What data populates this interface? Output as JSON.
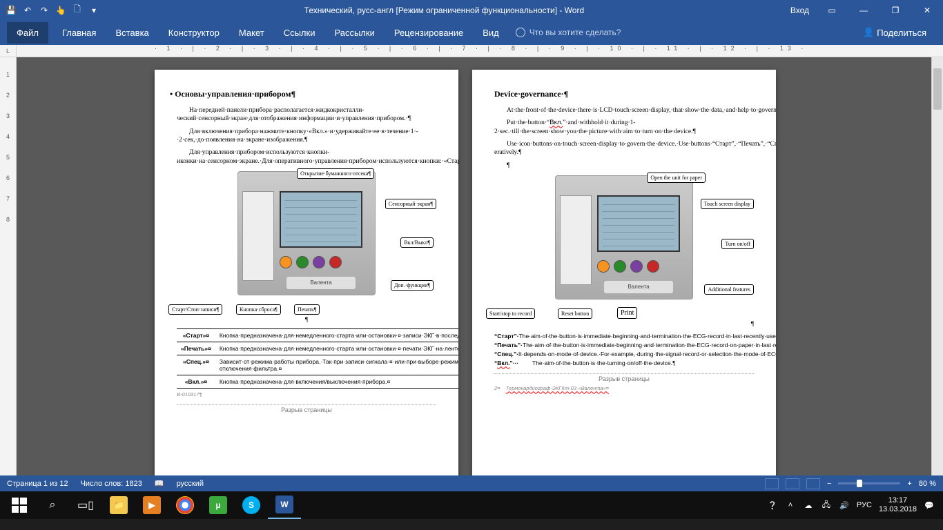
{
  "titlebar": {
    "title": "Технический, русс-англ [Режим ограниченной функциональности] - Word",
    "signin": "Вход"
  },
  "ribbon": {
    "file": "Файл",
    "home": "Главная",
    "insert": "Вставка",
    "design": "Конструктор",
    "layout": "Макет",
    "references": "Ссылки",
    "mailings": "Рассылки",
    "review": "Рецензирование",
    "view": "Вид",
    "tellme": "Что вы хотите сделать?",
    "share": "Поделиться"
  },
  "ruler": {
    "h": "· 1 · | · 2 · | · 3 · | · 4 · | · 5 · | · 6 · | · 7 · | · 8 · | · 9 · | · 10 · | · 11 · | · 12 · | · 13 ·",
    "corner": "L"
  },
  "page_left": {
    "heading": "Основы·управления·прибором¶",
    "p1": "На·передней·панели·прибора·располагается·жидкокристалли­ческий·сенсорный·экран·для·отображения·информации·и·управления·прибором.·¶",
    "p2": "Для·включения·прибора·нажмите·кнопку·«Вкл.»·и·удержи­вайте·ее·в·течение·1·-·2·сек,·до·появления·на·экране·изобра­жения.¶",
    "p3": "Для·управления·прибором·используются·кнопки-иконки·на·сенсорном·экране.·Для·оперативного·управления·прибором·используются·кнопки:·«Старт»,·«Печать»,·«Спец.».¶",
    "callouts": {
      "c1": "Открытие·бумажного·отсека¶",
      "c2": "Сенсорный·экран¶",
      "c3": "Вкл/Выкл¶",
      "c4": "Доп.·функции¶",
      "c5": "Старт/Стоп·записи¶",
      "c6": "Кнопка·сброса¶",
      "c7": "Печать¶"
    },
    "device_logo": "Валента",
    "para_sym": "¶",
    "table": [
      {
        "k": "«Старт»¤",
        "v": "Кнопка·предназначена·для·немедленного·старта·или·остановки·¤·записи·ЭКГ·в·последнем·использованном·режиме.·¤"
      },
      {
        "k": "«Печать»¤",
        "v": "Кнопка·предназначена·для·немедленного·старта·или·остановки·¤·печати·ЭКГ·на·ленте·в·последнем·использованном·режиме.¤"
      },
      {
        "k": "«Спец.»¤",
        "v": "Зависит·от·режима·работы·прибора.·Так·при·записи·сигнала·¤·или·при·выборе·режима·печати·ЭКГ·кнопка·«Спец.»·служит·¤·для·включения/отключения·фильтра.¤"
      },
      {
        "k": "«Вкл.»¤",
        "v": "Кнопка·предназначена·для·включения/выключения·прибора.¤"
      }
    ],
    "footnote": "В-010317¶",
    "pagebreak": "Разрыв страницы"
  },
  "page_right": {
    "heading": "Device·governance·¶",
    "p1": "At·the·front·of·the·device·there·is·LCD·touch·screen·display,·that·show·the·data,·and·help·to·govern·the·device.¶",
    "p2": "Put·the·button·“Вкл.”·and·withhold·it·during·1-2·sec.·till·the·screen·show·you·the·picture·with·aim·to·turn·on·the·device.¶",
    "p3": "Use·icon·buttons·on·touch·screen·display·to·govern·the·device.·Use·buttons·“Старт”,·“Печать”,·“Спец.”·for·govern·the·device·op­eratively.¶",
    "p4": "¶",
    "callouts": {
      "c1": "Open the unit for paper",
      "c2": "Touch screen display",
      "c3": "Turn on/off",
      "c4": "Additional features",
      "c5": "Start/stop to record",
      "c6": "Reset button",
      "c7": "Print"
    },
    "device_logo": "Валента",
    "para_sym": "¶",
    "defs": [
      {
        "k": "“Старт”·",
        "v": "The·aim·of·the·button·is·immediate·beginning·and·termination·the·ECG·record·in·last·recently·used·mode.¶"
      },
      {
        "k": "“Печать”·",
        "v": "The·aim·of·the·button·is·immediate·beginning·and·termination·the·ECG·record·on·paper·in·last·recently·used·mode¶"
      },
      {
        "k": "“Спец.”·",
        "v": "It·depends·on·mode·of·device.·For·example,·during·the·signal·record·or·selection·the·mode·of·ECG·print·the·aim·of·the·button·is·the·turning·on/off·the·filter.¶"
      },
      {
        "k": "“Вкл.”···",
        "v": "The·aim·of·the·button·is·the·turning·on/off·the·device.¶"
      }
    ],
    "pagebreak": "Разрыв страницы",
    "footnote_num": "2¤",
    "footnote": "Термокардиограф·ЭКГКm-03·«Валента»¤"
  },
  "status": {
    "page": "Страница 1 из 12",
    "words": "Число слов: 1823",
    "lang": "русский",
    "zoom": "80 %",
    "zoom_plus": "+",
    "zoom_minus": "−"
  },
  "taskbar": {
    "lang": "РУС",
    "time": "13:17",
    "date": "13.03.2018"
  }
}
